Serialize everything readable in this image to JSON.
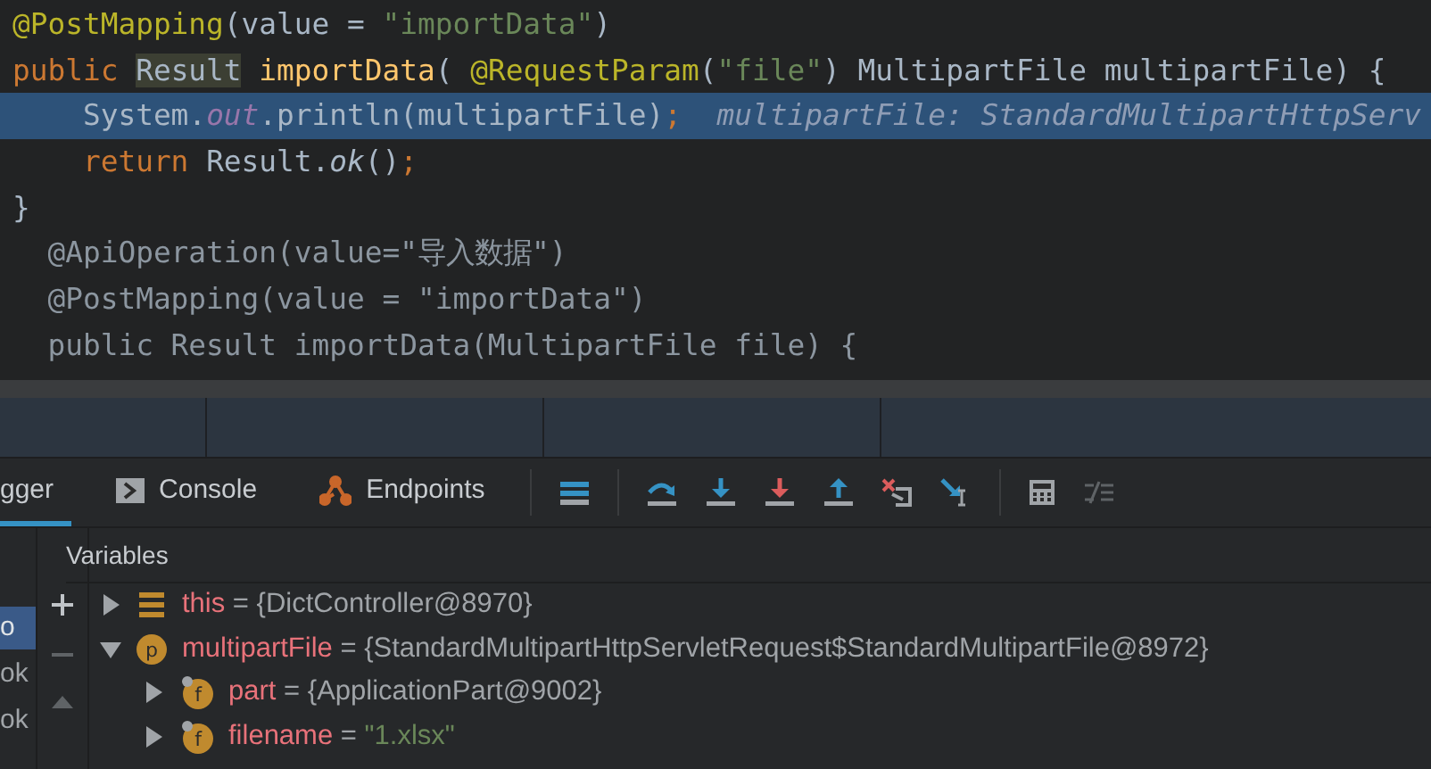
{
  "editor": {
    "lines": [
      {
        "selected": false,
        "tokens": [
          {
            "text": "@PostMapping",
            "kind": "annotation"
          },
          {
            "text": "(value = ",
            "kind": "plain"
          },
          {
            "text": "\"importData\"",
            "kind": "string"
          },
          {
            "text": ")",
            "kind": "plain"
          }
        ]
      },
      {
        "selected": false,
        "tokens": [
          {
            "text": "public ",
            "kind": "keyword"
          },
          {
            "text": "Result",
            "kind": "highlight"
          },
          {
            "text": " importData",
            "kind": "method"
          },
          {
            "text": "( ",
            "kind": "plain"
          },
          {
            "text": "@RequestParam",
            "kind": "annotation"
          },
          {
            "text": "(",
            "kind": "plain"
          },
          {
            "text": "\"file\"",
            "kind": "string"
          },
          {
            "text": ") MultipartFile multipartFile) {",
            "kind": "plain"
          }
        ]
      },
      {
        "selected": true,
        "tokens": [
          {
            "text": "    System.",
            "kind": "plain"
          },
          {
            "text": "out",
            "kind": "field"
          },
          {
            "text": ".println(multipartFile)",
            "kind": "plain"
          },
          {
            "text": ";",
            "kind": "keyword"
          },
          {
            "text": "  multipartFile: StandardMultipartHttpServ",
            "kind": "hint"
          }
        ]
      },
      {
        "selected": false,
        "tokens": [
          {
            "text": "    return ",
            "kind": "keyword"
          },
          {
            "text": "Result.",
            "kind": "plain"
          },
          {
            "text": "ok",
            "kind": "italic"
          },
          {
            "text": "()",
            "kind": "plain"
          },
          {
            "text": ";",
            "kind": "keyword"
          }
        ]
      },
      {
        "selected": false,
        "tokens": [
          {
            "text": "}",
            "kind": "plain"
          }
        ]
      },
      {
        "selected": false,
        "tokens": [
          {
            "text": "  @ApiOperation(value=\"导入数据\")",
            "kind": "dim"
          }
        ]
      },
      {
        "selected": false,
        "tokens": [
          {
            "text": "  @PostMapping(value = \"importData\")",
            "kind": "dim"
          }
        ]
      },
      {
        "selected": false,
        "tokens": [
          {
            "text": "  public Result importData(MultipartFile file) {",
            "kind": "dim"
          }
        ]
      }
    ]
  },
  "debugger": {
    "tabs": [
      {
        "label": "gger",
        "kind": "debugger",
        "selected": true
      },
      {
        "label": "Console",
        "kind": "console",
        "selected": false
      },
      {
        "label": "Endpoints",
        "kind": "endpoints",
        "selected": false
      }
    ],
    "frames": [
      {
        "label": "o",
        "selected": true
      },
      {
        "label": "ok",
        "selected": false
      },
      {
        "label": "ok",
        "selected": false
      }
    ],
    "variables_title": "Variables",
    "variables": [
      {
        "name": "this",
        "operator": "=",
        "value": "{DictController@8970}",
        "kind": "object",
        "is_string": false,
        "expanded": false
      },
      {
        "name": "multipartFile",
        "operator": "=",
        "value": "{StandardMultipartHttpServletRequest$StandardMultipartFile@8972}",
        "kind": "param",
        "badge": "p",
        "is_string": false,
        "expanded": true,
        "children": [
          {
            "name": "part",
            "operator": "=",
            "value": "{ApplicationPart@9002}",
            "kind": "field",
            "badge": "f",
            "is_string": false,
            "expanded": false
          },
          {
            "name": "filename",
            "operator": "=",
            "value": "\"1.xlsx\"",
            "kind": "field",
            "badge": "f",
            "is_string": true,
            "expanded": false
          }
        ]
      }
    ]
  }
}
